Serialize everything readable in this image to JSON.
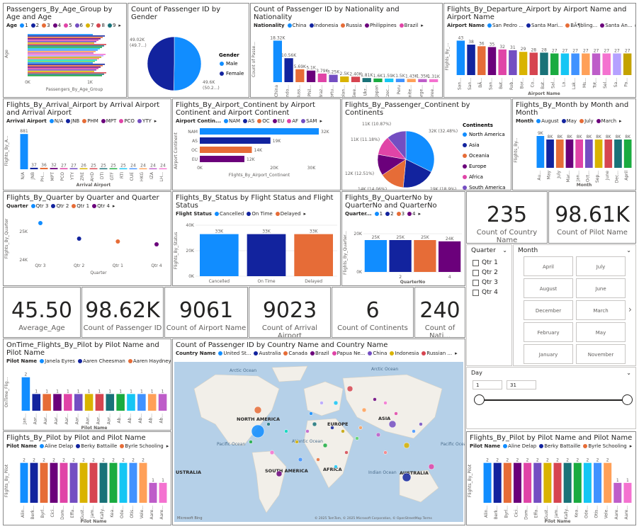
{
  "age_group": {
    "title": "Passengers_By_Age_Group by Age and Age",
    "legend_label": "Age",
    "legend": [
      {
        "name": "1",
        "color": "#118DFF"
      },
      {
        "name": "2",
        "color": "#12239E"
      },
      {
        "name": "3",
        "color": "#E66C37"
      },
      {
        "name": "4",
        "color": "#6B007B"
      },
      {
        "name": "5",
        "color": "#E044A7"
      },
      {
        "name": "6",
        "color": "#744EC2"
      },
      {
        "name": "7",
        "color": "#D9B300"
      },
      {
        "name": "8",
        "color": "#D64550"
      },
      {
        "name": "9",
        "color": "#197278"
      }
    ],
    "ylabel": "Age",
    "xlabel": "Passengers_By_Age_Group",
    "xticks": [
      "0K",
      "1K"
    ]
  },
  "gender": {
    "title": "Count of Passenger ID by Gender",
    "legend_title": "Gender",
    "slices": [
      {
        "name": "Male",
        "color": "#118DFF",
        "label": "49.6K",
        "pct": "(50.2...)",
        "value": 49.6
      },
      {
        "name": "Female",
        "color": "#12239E",
        "label": "49.02K",
        "pct": "(49.7...)",
        "value": 49.02
      }
    ]
  },
  "nationality": {
    "title": "Count of Passenger ID by Nationality and Nationality",
    "legend_label": "Nationality",
    "legend": [
      {
        "name": "China",
        "color": "#118DFF"
      },
      {
        "name": "Indonesia",
        "color": "#12239E"
      },
      {
        "name": "Russia",
        "color": "#E66C37"
      },
      {
        "name": "Philippines",
        "color": "#6B007B"
      },
      {
        "name": "Brazil",
        "color": "#E044A7"
      }
    ],
    "ylabel": "Count of Passe...",
    "xlabel": "Nationality",
    "bars": [
      {
        "cat": "China",
        "value": 18.32,
        "label": "18.32K"
      },
      {
        "cat": "Indo...",
        "value": 10.56,
        "label": "10.56K"
      },
      {
        "cat": "Russ...",
        "value": 5.69,
        "label": "5.69K"
      },
      {
        "cat": "Phil...",
        "value": 5.1,
        "label": "5.1K"
      },
      {
        "cat": "Braz...",
        "value": 3.79,
        "label": "3.79K"
      },
      {
        "cat": "Portu...",
        "value": 3.25,
        "label": "3.25K"
      },
      {
        "cat": "Polan...",
        "value": 2.5,
        "label": "2.5K"
      },
      {
        "cat": "Swe...",
        "value": 2.4,
        "label": "2.40K"
      },
      {
        "cat": "Ukr...",
        "value": 1.81,
        "label": "1.81K"
      },
      {
        "cat": "Japan",
        "value": 1.6,
        "label": "1.6K"
      },
      {
        "cat": "Czec...",
        "value": 1.59,
        "label": "1.59K"
      },
      {
        "cat": "Peru",
        "value": 1.5,
        "label": "1.5K"
      },
      {
        "cat": "Unite...",
        "value": 1.43,
        "label": "1.43K"
      },
      {
        "cat": "Arge...",
        "value": 1.35,
        "label": "1.35K"
      },
      {
        "cat": "Gree...",
        "value": 1.31,
        "label": "1.31K"
      }
    ]
  },
  "departure": {
    "title": "Flights_By_Departure_Airport by Airport Name and Airport Name",
    "legend_label": "Airport Name",
    "legend": [
      {
        "name": "San Pedro ...",
        "color": "#118DFF"
      },
      {
        "name": "Santa Mari...",
        "color": "#12239E"
      },
      {
        "name": "BÃ¶bling...",
        "color": "#E66C37"
      },
      {
        "name": "Santa An...",
        "color": "#6B007B"
      }
    ],
    "ylabel": "Flights_By_...",
    "xlabel": "Airport Name",
    "bars": [
      {
        "cat": "San...",
        "value": 43
      },
      {
        "cat": "San...",
        "value": 38
      },
      {
        "cat": "BÃ...",
        "value": 36
      },
      {
        "cat": "San...",
        "value": 35
      },
      {
        "cat": "Bet...",
        "value": 32
      },
      {
        "cat": "Rob...",
        "value": 31
      },
      {
        "cat": "Bor...",
        "value": 29
      },
      {
        "cat": "Co...",
        "value": 28
      },
      {
        "cat": "Bat...",
        "value": 28
      },
      {
        "cat": "Sal...",
        "value": 27
      },
      {
        "cat": "La...",
        "value": 27
      },
      {
        "cat": "Lak...",
        "value": 27
      },
      {
        "cat": "Ms...",
        "value": 27
      },
      {
        "cat": "Tot...",
        "value": 27
      },
      {
        "cat": "Sel...",
        "value": 27
      },
      {
        "cat": "Sa...",
        "value": 27
      },
      {
        "cat": "Pa...",
        "value": 27
      }
    ]
  },
  "arrival": {
    "title": "Flights_By_Arrival_Airport by Arrival Airport and Arrival Airport",
    "legend_label": "Arrival Airport",
    "legend": [
      {
        "name": "N/A",
        "color": "#118DFF"
      },
      {
        "name": "JNB",
        "color": "#12239E"
      },
      {
        "name": "PHM",
        "color": "#E66C37"
      },
      {
        "name": "MPT",
        "color": "#6B007B"
      },
      {
        "name": "PCO",
        "color": "#E044A7"
      },
      {
        "name": "YTY",
        "color": "#744EC2"
      }
    ],
    "ylabel": "Flights_By_A...",
    "xlabel": "Arrival Airport",
    "bars": [
      {
        "cat": "N/A",
        "value": 881
      },
      {
        "cat": "JNB",
        "value": 37
      },
      {
        "cat": "PH...",
        "value": 36
      },
      {
        "cat": "MPT",
        "value": 32
      },
      {
        "cat": "PCO",
        "value": 27
      },
      {
        "cat": "YTY",
        "value": 27
      },
      {
        "cat": "ZRE",
        "value": 26
      },
      {
        "cat": "AHD",
        "value": 25
      },
      {
        "cat": "DTI",
        "value": 25
      },
      {
        "cat": "GTF",
        "value": 25
      },
      {
        "cat": "RTI",
        "value": 25
      },
      {
        "cat": "CUE",
        "value": 24
      },
      {
        "cat": "HKG",
        "value": 24
      },
      {
        "cat": "IZA",
        "value": 24
      },
      {
        "cat": "LH...",
        "value": 24
      }
    ]
  },
  "continent_airport": {
    "title": "Flights_By_Airport_Continent by Airport Continent and Airport Continent",
    "legend_label": "Airport Contin...",
    "legend": [
      {
        "name": "NAM",
        "color": "#118DFF"
      },
      {
        "name": "AS",
        "color": "#12239E"
      },
      {
        "name": "OC",
        "color": "#E66C37"
      },
      {
        "name": "EU",
        "color": "#6B007B"
      },
      {
        "name": "AF",
        "color": "#E044A7"
      },
      {
        "name": "SAM",
        "color": "#744EC2"
      }
    ],
    "ylabel": "Airport Continent",
    "xlabel": "Flights_By_Airport_Continent",
    "xticks": [
      "0K",
      "20K",
      "30K"
    ],
    "bars": [
      {
        "cat": "NAM",
        "value": 32,
        "label": "32K",
        "color": "#118DFF"
      },
      {
        "cat": "AS",
        "value": 19,
        "label": "19K",
        "color": "#12239E"
      },
      {
        "cat": "OC",
        "value": 14,
        "label": "14K",
        "color": "#E66C37"
      },
      {
        "cat": "EU",
        "value": 12,
        "label": "12K",
        "color": "#6B007B"
      }
    ]
  },
  "passenger_continent": {
    "title": "Flights_By_Passenger_Continent by Continents",
    "legend_title": "Continents",
    "slices": [
      {
        "name": "North America",
        "color": "#118DFF",
        "value": 32,
        "label": "32K",
        "pct": "(32.48%)"
      },
      {
        "name": "Asia",
        "color": "#12239E",
        "value": 19,
        "label": "19K",
        "pct": "(18.9%)"
      },
      {
        "name": "Oceania",
        "color": "#E66C37",
        "value": 14,
        "label": "14K",
        "pct": "(14.06%)"
      },
      {
        "name": "Europe",
        "color": "#6B007B",
        "value": 12,
        "label": "12K",
        "pct": "(12.51%)"
      },
      {
        "name": "Africa",
        "color": "#E044A7",
        "value": 11,
        "label": "11K",
        "pct": "(11.18%)"
      },
      {
        "name": "South America",
        "color": "#744EC2",
        "value": 11,
        "label": "11K",
        "pct": "(10.87%)"
      }
    ]
  },
  "month": {
    "title": "Flights_By_Month by Month and Month",
    "legend_label": "Month",
    "legend": [
      {
        "name": "August",
        "color": "#118DFF"
      },
      {
        "name": "May",
        "color": "#12239E"
      },
      {
        "name": "July",
        "color": "#E66C37"
      },
      {
        "name": "March",
        "color": "#6B007B"
      }
    ],
    "ylabel": "Flights_By...",
    "xlabel": "Month",
    "bars": [
      {
        "cat": "Au...",
        "value": 9,
        "label": "9K",
        "color": "#118DFF"
      },
      {
        "cat": "May",
        "value": 8,
        "label": "8K",
        "color": "#12239E"
      },
      {
        "cat": "July",
        "value": 8,
        "label": "8K",
        "color": "#E66C37"
      },
      {
        "cat": "Mar...",
        "value": 8,
        "label": "8K",
        "color": "#6B007B"
      },
      {
        "cat": "Jan...",
        "value": 8,
        "label": "8K",
        "color": "#E044A7"
      },
      {
        "cat": "Oct...",
        "value": 8,
        "label": "8K",
        "color": "#744EC2"
      },
      {
        "cat": "Sep...",
        "value": 8,
        "label": "8K",
        "color": "#D9B300"
      },
      {
        "cat": "June",
        "value": 8,
        "label": "8K",
        "color": "#D64550"
      },
      {
        "cat": "Dec...",
        "value": 8,
        "label": "8K",
        "color": "#197278"
      },
      {
        "cat": "April",
        "value": 8,
        "label": "8K",
        "color": "#1AAB40"
      }
    ]
  },
  "quarter": {
    "title": "Flights_By_Quarter by Quarter and Quarter",
    "legend_label": "Quarter",
    "legend": [
      {
        "name": "Qtr 3",
        "color": "#118DFF"
      },
      {
        "name": "Qtr 2",
        "color": "#12239E"
      },
      {
        "name": "Qtr 1",
        "color": "#E66C37"
      },
      {
        "name": "Qtr 4",
        "color": "#6B007B"
      }
    ],
    "ylabel": "Flights_By_Quarter",
    "xlabel": "Quarter",
    "yticks": [
      "25K",
      "24K"
    ],
    "points": [
      {
        "cat": "Qtr 3",
        "value": 25.3,
        "color": "#118DFF"
      },
      {
        "cat": "Qtr 2",
        "value": 24.75,
        "color": "#12239E"
      },
      {
        "cat": "Qtr 1",
        "value": 24.65,
        "color": "#E66C37"
      },
      {
        "cat": "Qtr 4",
        "value": 24.55,
        "color": "#6B007B"
      }
    ]
  },
  "status": {
    "title": "Flights_By_Status by Flight Status and Flight Status",
    "legend_label": "Flight Status",
    "legend": [
      {
        "name": "Cancelled",
        "color": "#118DFF"
      },
      {
        "name": "On Time",
        "color": "#12239E"
      },
      {
        "name": "Delayed",
        "color": "#E66C37"
      }
    ],
    "ylabel": "Flights_By_Status",
    "xlabel": "Flight Status",
    "yticks": [
      "40K",
      "20K",
      "0K"
    ],
    "bars": [
      {
        "cat": "Cancelled",
        "value": 33,
        "label": "33K",
        "color": "#118DFF"
      },
      {
        "cat": "On Time",
        "value": 33,
        "label": "33K",
        "color": "#12239E"
      },
      {
        "cat": "Delayed",
        "value": 33,
        "label": "33K",
        "color": "#E66C37"
      }
    ]
  },
  "quarterno": {
    "title": "Flights_By_QuarterNo by QuarterNo and QuarterNo",
    "legend_label": "Quarter...",
    "legend": [
      {
        "name": "1",
        "color": "#118DFF"
      },
      {
        "name": "2",
        "color": "#12239E"
      },
      {
        "name": "3",
        "color": "#E66C37"
      },
      {
        "name": "4",
        "color": "#6B007B"
      }
    ],
    "ylabel": "Flights_By_Quarter...",
    "xlabel": "QuarterNo",
    "yticks": [
      "20K",
      "0K"
    ],
    "bars": [
      {
        "cat": "",
        "value": 25,
        "label": "25K",
        "color": "#118DFF"
      },
      {
        "cat": "2",
        "value": 25,
        "label": "25K",
        "color": "#12239E"
      },
      {
        "cat": "",
        "value": 25,
        "label": "25K",
        "color": "#E66C37"
      },
      {
        "cat": "4",
        "value": 24,
        "label": "24K",
        "color": "#6B007B"
      }
    ]
  },
  "kpis": {
    "country_count": {
      "value": "235",
      "label": "Count of Country Name"
    },
    "pilot_count": {
      "value": "98.61K",
      "label": "Count of Pilot Name"
    },
    "avg_age": {
      "value": "45.50",
      "label": "Average_Age"
    },
    "passenger_count": {
      "value": "98.62K",
      "label": "Count of Passenger ID"
    },
    "airport_count": {
      "value": "9061",
      "label": "Count of Airport Name"
    },
    "arrival_count": {
      "value": "9023",
      "label": "Count of Arrival Airport"
    },
    "continents_count": {
      "value": "6",
      "label": "Count of Continents"
    },
    "nationality_count": {
      "value": "240",
      "label": "Count of Nati..."
    }
  },
  "quarter_slicer": {
    "title": "Quarter",
    "items": [
      "Qtr 1",
      "Qtr 2",
      "Qtr 3",
      "Qtr 4"
    ]
  },
  "month_slicer": {
    "title": "Month",
    "items": [
      "April",
      "July",
      "August",
      "June",
      "December",
      "March",
      "February",
      "May",
      "January",
      "November"
    ]
  },
  "day_slicer": {
    "title": "Day",
    "min": "1",
    "max": "31"
  },
  "ontime_pilot": {
    "title": "OnTime_Flights_By_Pilot by Pilot Name and Pilot Name",
    "legend_label": "Pilot Name",
    "legend": [
      {
        "name": "Janela Eyres",
        "color": "#118DFF"
      },
      {
        "name": "Aaren Cheesman",
        "color": "#12239E"
      },
      {
        "name": "Aaren Haydney",
        "color": "#E66C37"
      }
    ],
    "ylabel": "OnTime_Flig...",
    "xlabel": "Pilot Name",
    "bars": [
      {
        "cat": "Jan...",
        "value": 2,
        "label": "2"
      },
      {
        "cat": "Aar...",
        "value": 1,
        "label": "1"
      },
      {
        "cat": "Aar...",
        "value": 1,
        "label": "1"
      },
      {
        "cat": "Aar...",
        "value": 1,
        "label": "1"
      },
      {
        "cat": "Aar...",
        "value": 1,
        "label": "1"
      },
      {
        "cat": "Aar...",
        "value": 1,
        "label": "1"
      },
      {
        "cat": "Aar...",
        "value": 1,
        "label": "1"
      },
      {
        "cat": "Aar...",
        "value": 1,
        "label": "1"
      },
      {
        "cat": "Aar...",
        "value": 1,
        "label": "1"
      },
      {
        "cat": "Ab...",
        "value": 1,
        "label": "1"
      },
      {
        "cat": "Ab...",
        "value": 1,
        "label": "1"
      },
      {
        "cat": "Ab...",
        "value": 1,
        "label": "1"
      },
      {
        "cat": "Ab...",
        "value": 1,
        "label": "1"
      },
      {
        "cat": "Ab...",
        "value": 1,
        "label": "1"
      }
    ]
  },
  "map": {
    "title": "Count of Passenger ID by Country Name and Country Name",
    "legend_label": "Country Name",
    "legend": [
      {
        "name": "United St...",
        "color": "#118DFF"
      },
      {
        "name": "Australia",
        "color": "#12239E"
      },
      {
        "name": "Canada",
        "color": "#E66C37"
      },
      {
        "name": "Brazil",
        "color": "#6B007B"
      },
      {
        "name": "Papua Ne...",
        "color": "#E044A7"
      },
      {
        "name": "China",
        "color": "#744EC2"
      },
      {
        "name": "Indonesia",
        "color": "#D9B300"
      },
      {
        "name": "Russian ...",
        "color": "#D64550"
      }
    ],
    "labels": {
      "arctic1": "Arctic Ocean",
      "arctic2": "Arctic Ocean",
      "na": "NORTH AMERICA",
      "eu": "EUROPE",
      "asia": "ASIA",
      "africa": "AFRICA",
      "sa": "SOUTH AMERICA",
      "aus": "AUSTRALIA",
      "aus_left": "USTRALIA",
      "pac1": "Pacific Ocean",
      "pac2": "Pacific Ocean",
      "atl": "Atlantic Ocean",
      "ind": "Indian Ocean"
    },
    "attribution": "© 2025 TomTom, © 2025 Microsoft Corporation, © OpenStreetMap  Terms",
    "bing": "Microsoft Bing"
  },
  "pilot_left": {
    "title": "Flights_By_Pilot by Pilot and Pilot Name",
    "legend_label": "Pilot Name",
    "legend": [
      {
        "name": "Aline Delap",
        "color": "#118DFF"
      },
      {
        "name": "Berky Battaille",
        "color": "#12239E"
      },
      {
        "name": "Byrle Schooling",
        "color": "#E66C37"
      }
    ],
    "ylabel": "Flights_By_Pilot",
    "xlabel": "Pilot Name",
    "bars": [
      {
        "cat": "Alin...",
        "value": 2
      },
      {
        "cat": "Berk...",
        "value": 2
      },
      {
        "cat": "Byrl...",
        "value": 2
      },
      {
        "cat": "Cici...",
        "value": 2
      },
      {
        "cat": "Dom...",
        "value": 2
      },
      {
        "cat": "Effa...",
        "value": 2
      },
      {
        "cat": "Gust...",
        "value": 2
      },
      {
        "cat": "Jam...",
        "value": 2
      },
      {
        "cat": "Kally...",
        "value": 2
      },
      {
        "cat": "Kea...",
        "value": 2
      },
      {
        "cat": "Ode...",
        "value": 2
      },
      {
        "cat": "Otis...",
        "value": 2
      },
      {
        "cat": "Vele...",
        "value": 2
      },
      {
        "cat": "Aare...",
        "value": 1
      },
      {
        "cat": "Aare...",
        "value": 1
      }
    ]
  },
  "pilot_right": {
    "title": "Flights_By_Pilot by Pilot Name and Pilot Name",
    "legend_label": "Pilot Name",
    "legend": [
      {
        "name": "Aline Delap",
        "color": "#118DFF"
      },
      {
        "name": "Berky Battaille",
        "color": "#12239E"
      },
      {
        "name": "Byrle Schooling",
        "color": "#E66C37"
      }
    ],
    "ylabel": "Flights_By_Pilot",
    "xlabel": "Pilot Name",
    "bars": [
      {
        "cat": "Alin...",
        "value": 2
      },
      {
        "cat": "Berk...",
        "value": 2
      },
      {
        "cat": "Byrl...",
        "value": 2
      },
      {
        "cat": "Cici...",
        "value": 2
      },
      {
        "cat": "Dom...",
        "value": 2
      },
      {
        "cat": "Effa...",
        "value": 2
      },
      {
        "cat": "Gust...",
        "value": 2
      },
      {
        "cat": "Jam...",
        "value": 2
      },
      {
        "cat": "Kally...",
        "value": 2
      },
      {
        "cat": "Kea...",
        "value": 2
      },
      {
        "cat": "Ode...",
        "value": 2
      },
      {
        "cat": "Otis...",
        "value": 2
      },
      {
        "cat": "Vele...",
        "value": 2
      },
      {
        "cat": "Aare...",
        "value": 1
      },
      {
        "cat": "Aare...",
        "value": 1
      }
    ]
  },
  "palette": [
    "#118DFF",
    "#12239E",
    "#E66C37",
    "#6B007B",
    "#E044A7",
    "#744EC2",
    "#D9B300",
    "#D64550",
    "#197278",
    "#1AAB40",
    "#15C6F4",
    "#4092FF",
    "#FFA058",
    "#BE5DC9",
    "#F472D0",
    "#B5A1FF",
    "#C4A200",
    "#FF8080",
    "#00DBBC",
    "#5BD667"
  ]
}
